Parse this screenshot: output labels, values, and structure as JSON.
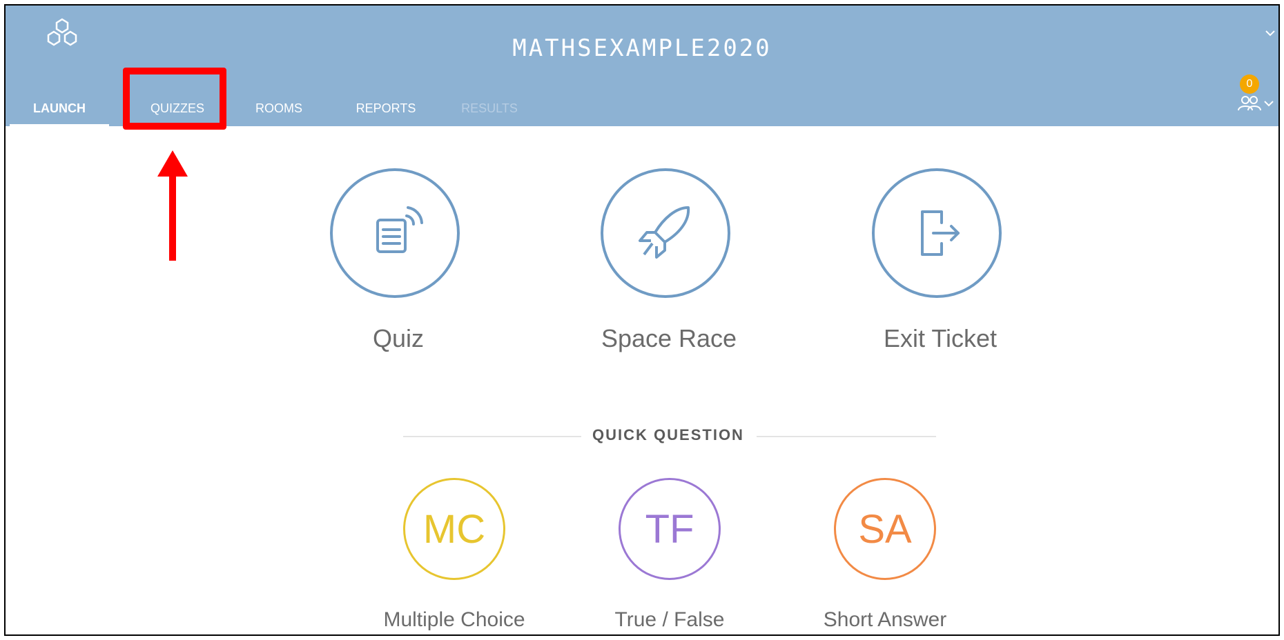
{
  "header": {
    "title": "MATHSEXAMPLE2020",
    "logo_icon": "hexagon-network-logo-icon",
    "background_color": "#8db2d3"
  },
  "tabs": [
    {
      "label": "LAUNCH",
      "active": true
    },
    {
      "label": "QUIZZES",
      "highlighted": true
    },
    {
      "label": "ROOMS"
    },
    {
      "label": "REPORTS"
    },
    {
      "label": "RESULTS",
      "disabled": true
    }
  ],
  "user_menu": {
    "badge_count": "0",
    "icon": "users-icon",
    "badge_color": "#f4a700"
  },
  "launch_options": [
    {
      "label": "Quiz",
      "icon": "quiz-document-broadcast-icon"
    },
    {
      "label": "Space Race",
      "icon": "rocket-icon"
    },
    {
      "label": "Exit Ticket",
      "icon": "exit-door-icon"
    }
  ],
  "quick_question": {
    "title": "QUICK QUESTION",
    "options": [
      {
        "abbr": "MC",
        "label": "Multiple Choice",
        "color": "#e7c52f"
      },
      {
        "abbr": "TF",
        "label": "True / False",
        "color": "#9b78d4"
      },
      {
        "abbr": "SA",
        "label": "Short Answer",
        "color": "#f28a45"
      }
    ]
  },
  "annotation": {
    "highlight_color": "#ff0000"
  }
}
